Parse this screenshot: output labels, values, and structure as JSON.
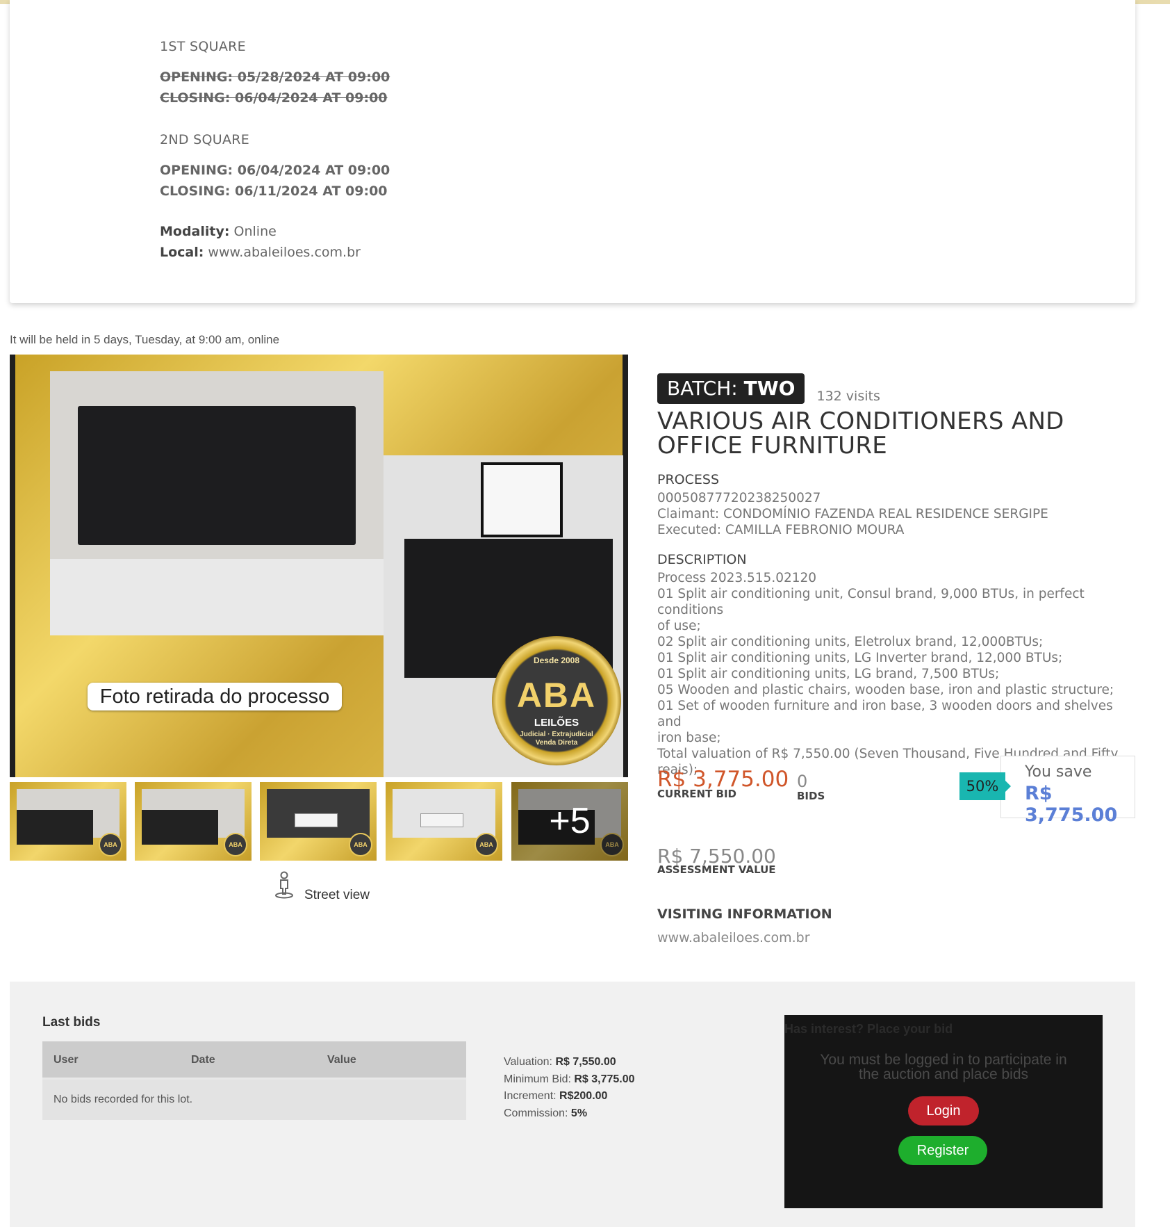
{
  "schedule": {
    "first": {
      "title": "1ST SQUARE",
      "opening": "OPENING: 05/28/2024 AT 09:00",
      "closing": "CLOSING: 06/04/2024 AT 09:00"
    },
    "second": {
      "title": "2ND SQUARE",
      "opening": "OPENING: 06/04/2024 AT 09:00",
      "closing": "CLOSING: 06/11/2024 AT 09:00"
    },
    "modality_label": "Modality:",
    "modality_value": "Online",
    "local_label": "Local:",
    "local_value": "www.abaleiloes.com.br"
  },
  "held_text": "It will be held in 5 days, Tuesday, at 9:00 am, online",
  "gallery": {
    "caption": "Foto retirada do processo",
    "seal": {
      "since": "Desde 2008",
      "brand": "ABA",
      "sub": "LEILÕES",
      "tag1": "Judicial · Extrajudicial",
      "tag2": "Venda Direta"
    },
    "more_count": "+5",
    "thumb_badge": "ABA",
    "street_view": "Street view"
  },
  "lot": {
    "batch_label": "BATCH:",
    "batch_value": "TWO",
    "visits": "132 visits",
    "title_line1": "VARIOUS AIR CONDITIONERS AND",
    "title_line2": "OFFICE FURNITURE",
    "process_heading": "PROCESS",
    "process_number": "00050877720238250027",
    "claimant": "Claimant: CONDOMÍNIO FAZENDA REAL RESIDENCE SERGIPE",
    "executed": "Executed: CAMILLA FEBRONIO MOURA",
    "description_heading": "DESCRIPTION",
    "description": [
      "Process 2023.515.02120",
      "01 Split air conditioning unit, Consul brand, 9,000 BTUs, in perfect conditions",
      "of use;",
      "02 Split air conditioning units, Eletrolux brand, 12,000BTUs;",
      "01 Split air conditioning units, LG Inverter brand, 12,000 BTUs;",
      "01 Split air conditioning units, LG brand, 7,500 BTUs;",
      "05 Wooden and plastic chairs, wooden base, iron and plastic structure;",
      "01 Set of wooden furniture and iron base, 3 wooden doors and shelves and",
      "iron base;",
      "Total valuation of R$ 7,550.00 (Seven Thousand, Five Hundred and Fifty reais);"
    ]
  },
  "pricing": {
    "current_bid": "R$ 3,775.00",
    "current_bid_label": "CURRENT BID",
    "bids_count": "0",
    "bids_label": "BIDS",
    "discount": "50%",
    "save_label": "You save",
    "save_value": "R$ 3,775.00",
    "assessment": "R$ 7,550.00",
    "assessment_label": "ASSESSMENT VALUE",
    "visiting_heading": "VISITING INFORMATION",
    "visiting_value": "www.abaleiloes.com.br"
  },
  "last_bids": {
    "heading": "Last bids",
    "columns": [
      "User",
      "Date",
      "Value"
    ],
    "empty": "No bids recorded for this lot."
  },
  "summary": {
    "valuation_label": "Valuation:",
    "valuation": "R$ 7,550.00",
    "minimum_label": "Minimum Bid:",
    "minimum": "R$ 3,775.00",
    "increment_label": "Increment:",
    "increment": "R$200.00",
    "commission_label": "Commission:",
    "commission": "5%"
  },
  "bid_panel": {
    "heading": "Has interest? Place your bid",
    "message_line1": "You must be logged in to participate in",
    "message_line2": "the auction and place bids",
    "login": "Login",
    "register": "Register"
  },
  "colors": {
    "accent_gold": "#d9c577",
    "price_orange": "#d0562a",
    "save_blue": "#5b7fd6",
    "discount_teal": "#19b6b0",
    "login_red": "#c0232c",
    "register_green": "#1eae2d"
  }
}
